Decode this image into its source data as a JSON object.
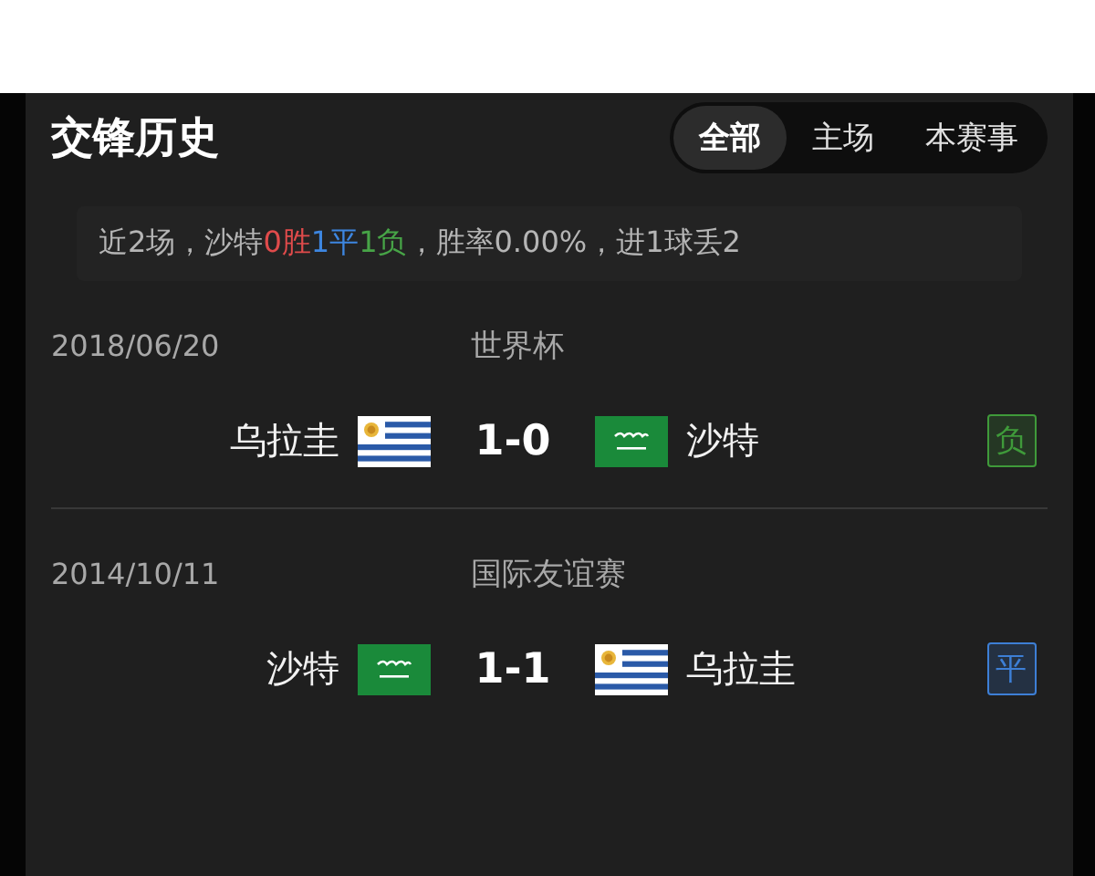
{
  "title": "交锋历史",
  "tabs": [
    {
      "label": "全部",
      "selected": true
    },
    {
      "label": "主场",
      "selected": false
    },
    {
      "label": "本赛事",
      "selected": false
    }
  ],
  "summary": [
    {
      "kind": "plain",
      "text": "近2场，沙特"
    },
    {
      "kind": "win",
      "text": "0胜"
    },
    {
      "kind": "draw",
      "text": "1平"
    },
    {
      "kind": "loss",
      "text": "1负"
    },
    {
      "kind": "plain",
      "text": "，胜率0.00%，进1球丢2"
    }
  ],
  "matches": [
    {
      "date": "2018/06/20",
      "competition": "世界杯",
      "home": {
        "name": "乌拉圭",
        "kind": "uruguay"
      },
      "score": "1-0",
      "away": {
        "name": "沙特",
        "kind": "saudi"
      },
      "result": "负",
      "color": "#3f9a3a"
    },
    {
      "date": "2014/10/11",
      "competition": "国际友谊赛",
      "home": {
        "name": "沙特",
        "kind": "saudi"
      },
      "score": "1-1",
      "away": {
        "name": "乌拉圭",
        "kind": "uruguay"
      },
      "result": "平",
      "color": "#3d7fd6"
    }
  ]
}
